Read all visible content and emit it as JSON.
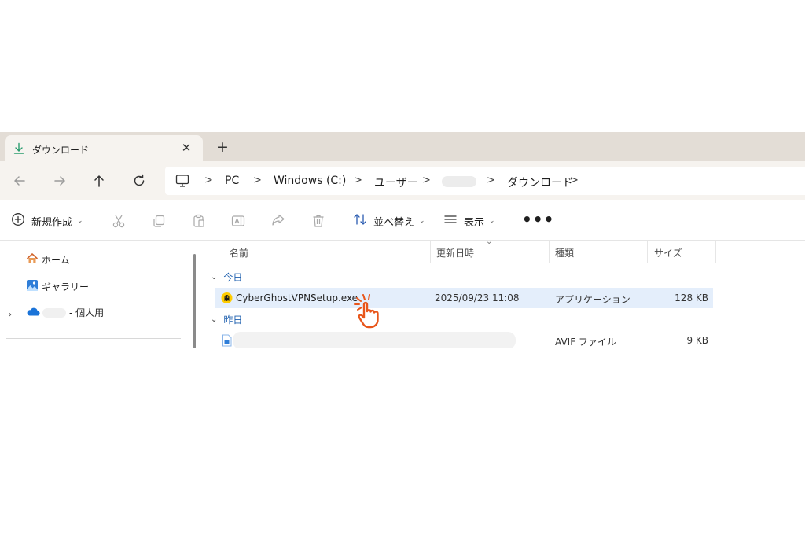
{
  "tab": {
    "title": "ダウンロード",
    "close_glyph": "✕",
    "new_glyph": "+"
  },
  "address": {
    "crumbs": [
      "PC",
      "Windows (C:)",
      "ユーザー",
      "ダウンロード"
    ],
    "separator": ">"
  },
  "toolbar": {
    "new_label": "新規作成",
    "sort_label": "並べ替え",
    "view_label": "表示",
    "more_glyph": "•••"
  },
  "sidebar": {
    "items": [
      {
        "label": "ホーム",
        "icon": "home-icon"
      },
      {
        "label": "ギャラリー",
        "icon": "gallery-icon"
      },
      {
        "label": "- 個人用",
        "icon": "onedrive-cloud-icon"
      }
    ]
  },
  "columns": {
    "name": "名前",
    "modified": "更新日時",
    "type": "種類",
    "size": "サイズ"
  },
  "groups": {
    "today": "今日",
    "yesterday": "昨日"
  },
  "files": [
    {
      "name": "CyberGhostVPNSetup.exe",
      "modified": "2025/09/23 11:08",
      "type": "アプリケーション",
      "size": "128 KB",
      "selected": true,
      "icon": "cyberghost-app-icon"
    },
    {
      "name": "",
      "modified": "",
      "type": "AVIF ファイル",
      "size": "9 KB",
      "selected": false,
      "icon": "image-file-icon"
    }
  ],
  "colors": {
    "accent": "#1d5fae",
    "selection": "#e4eefb",
    "tabstrip": "#e3ddd6",
    "pointer": "#e8561b"
  }
}
